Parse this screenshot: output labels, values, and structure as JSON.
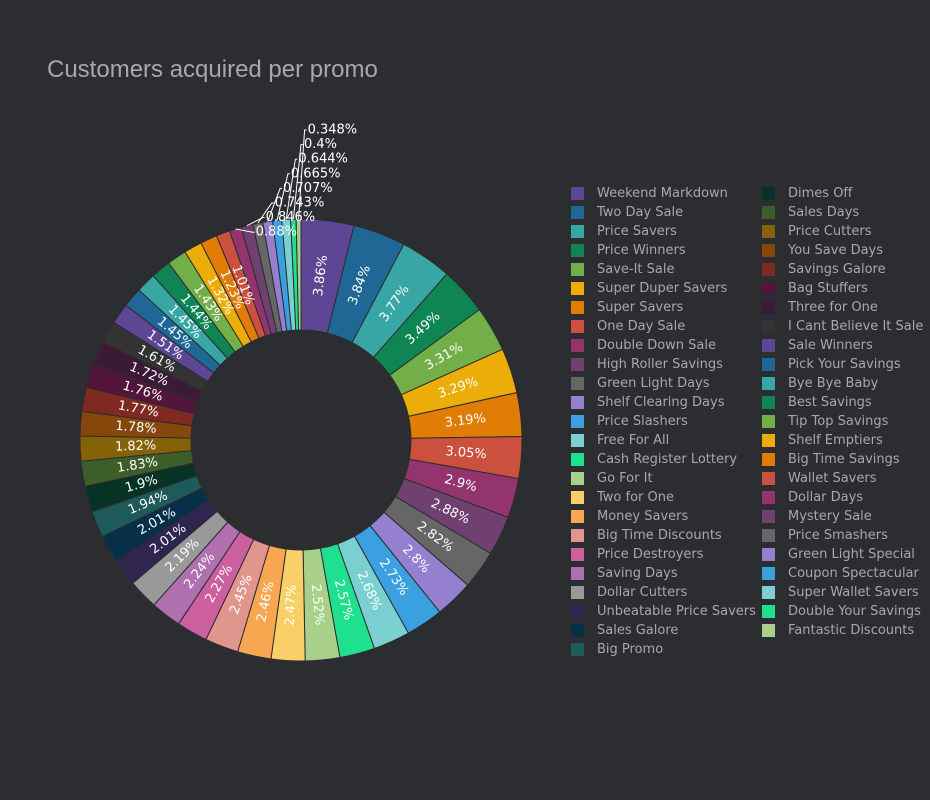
{
  "title": "Customers acquired per promo",
  "chart_data": {
    "type": "pie",
    "hole": true,
    "title": "Customers acquired per promo",
    "legend_position": "right",
    "slices": [
      {
        "label": "Weekend Markdown",
        "value": 3.86,
        "text": "3.86%",
        "color": "#5d4694"
      },
      {
        "label": "Two Day Sale",
        "value": 3.84,
        "text": "3.84%",
        "color": "#1f6896"
      },
      {
        "label": "Price Savers",
        "value": 3.77,
        "text": "3.77%",
        "color": "#38a6a5"
      },
      {
        "label": "Price Winners",
        "value": 3.49,
        "text": "3.49%",
        "color": "#0f8554"
      },
      {
        "label": "Save-It Sale",
        "value": 3.31,
        "text": "3.31%",
        "color": "#73af48"
      },
      {
        "label": "Super Duper Savers",
        "value": 3.29,
        "text": "3.29%",
        "color": "#edad08"
      },
      {
        "label": "Super Savers",
        "value": 3.19,
        "text": "3.19%",
        "color": "#e17c05"
      },
      {
        "label": "One Day Sale",
        "value": 3.05,
        "text": "3.05%",
        "color": "#cc503e"
      },
      {
        "label": "Double Down Sale",
        "value": 2.9,
        "text": "2.9%",
        "color": "#94346e"
      },
      {
        "label": "High Roller Savings",
        "value": 2.88,
        "text": "2.88%",
        "color": "#6f4070"
      },
      {
        "label": "Green Light Days",
        "value": 2.82,
        "text": "2.82%",
        "color": "#666666"
      },
      {
        "label": "Shelf Clearing Days",
        "value": 2.8,
        "text": "2.8%",
        "color": "#9580d0"
      },
      {
        "label": "Price Slashers",
        "value": 2.73,
        "text": "2.73%",
        "color": "#3ba0e0"
      },
      {
        "label": "Free For All",
        "value": 2.68,
        "text": "2.68%",
        "color": "#7ad0d0"
      },
      {
        "label": "Cash Register Lottery",
        "value": 2.57,
        "text": "2.57%",
        "color": "#1ee08e"
      },
      {
        "label": "Go For It",
        "value": 2.52,
        "text": "2.52%",
        "color": "#a8d08a"
      },
      {
        "label": "Two for One",
        "value": 2.47,
        "text": "2.47%",
        "color": "#f9d067"
      },
      {
        "label": "Money Savers",
        "value": 2.46,
        "text": "2.46%",
        "color": "#f8a650"
      },
      {
        "label": "Big Time Discounts",
        "value": 2.45,
        "text": "2.45%",
        "color": "#e0968c"
      },
      {
        "label": "Price Destroyers",
        "value": 2.27,
        "text": "2.27%",
        "color": "#cc609e"
      },
      {
        "label": "Saving Days",
        "value": 2.24,
        "text": "2.24%",
        "color": "#b070b0"
      },
      {
        "label": "Dollar Cutters",
        "value": 2.19,
        "text": "2.19%",
        "color": "#999999"
      },
      {
        "label": "Unbeatable Price Savers",
        "value": 2.01,
        "text": "2.01%",
        "color": "#302550"
      },
      {
        "label": "Sales Galore",
        "value": 2.01,
        "text": "2.01%",
        "color": "#073048"
      },
      {
        "label": "Big Promo",
        "value": 1.94,
        "text": "1.94%",
        "color": "#1f5a5a"
      },
      {
        "label": "Dimes Off",
        "value": 1.9,
        "text": "1.9%",
        "color": "#063325"
      },
      {
        "label": "Sales Days",
        "value": 1.83,
        "text": "1.83%",
        "color": "#3e5e29"
      },
      {
        "label": "Price Cutters",
        "value": 1.82,
        "text": "1.82%",
        "color": "#856108"
      },
      {
        "label": "You Save Days",
        "value": 1.78,
        "text": "1.78%",
        "color": "#86480a"
      },
      {
        "label": "Savings Galore",
        "value": 1.77,
        "text": "1.77%",
        "color": "#7f2a20"
      },
      {
        "label": "Bag Stuffers",
        "value": 1.76,
        "text": "1.76%",
        "color": "#52163c"
      },
      {
        "label": "Three for One",
        "value": 1.72,
        "text": "1.72%",
        "color": "#3a1a36"
      },
      {
        "label": "I Cant Believe It Sale",
        "value": 1.61,
        "text": "1.61%",
        "color": "#333333"
      },
      {
        "label": "Sale Winners",
        "value": 1.51,
        "text": "1.51%",
        "color": "#5d4694"
      },
      {
        "label": "Pick Your Savings",
        "value": 1.45,
        "text": "1.45%",
        "color": "#1f6896"
      },
      {
        "label": "Bye Bye Baby",
        "value": 1.45,
        "text": "1.45%",
        "color": "#38a6a5"
      },
      {
        "label": "Best Savings",
        "value": 1.44,
        "text": "1.44%",
        "color": "#0f8554"
      },
      {
        "label": "Tip Top Savings",
        "value": 1.43,
        "text": "1.43%",
        "color": "#73af48"
      },
      {
        "label": "Shelf Emptiers",
        "value": 1.32,
        "text": "1.32%",
        "color": "#edad08"
      },
      {
        "label": "Big Time Savings",
        "value": 1.23,
        "text": "1.23%",
        "color": "#e17c05"
      },
      {
        "label": "Wallet Savers",
        "value": 1.01,
        "text": "1.01%",
        "color": "#cc503e"
      },
      {
        "label": "Dollar Days",
        "value": 0.88,
        "text": "0.88%",
        "color": "#94346e"
      },
      {
        "label": "Mystery Sale",
        "value": 0.846,
        "text": "0.846%",
        "color": "#6f4070"
      },
      {
        "label": "Price Smashers",
        "value": 0.743,
        "text": "0.743%",
        "color": "#666666"
      },
      {
        "label": "Green Light Special",
        "value": 0.707,
        "text": "0.707%",
        "color": "#9580d0"
      },
      {
        "label": "Coupon Spectacular",
        "value": 0.665,
        "text": "0.665%",
        "color": "#3ba0e0"
      },
      {
        "label": "Super Wallet Savers",
        "value": 0.644,
        "text": "0.644%",
        "color": "#7ad0d0"
      },
      {
        "label": "Double Your Savings",
        "value": 0.4,
        "text": "0.4%",
        "color": "#1ee08e"
      },
      {
        "label": "Fantastic Discounts",
        "value": 0.348,
        "text": "0.348%",
        "color": "#a8d08a"
      }
    ]
  }
}
